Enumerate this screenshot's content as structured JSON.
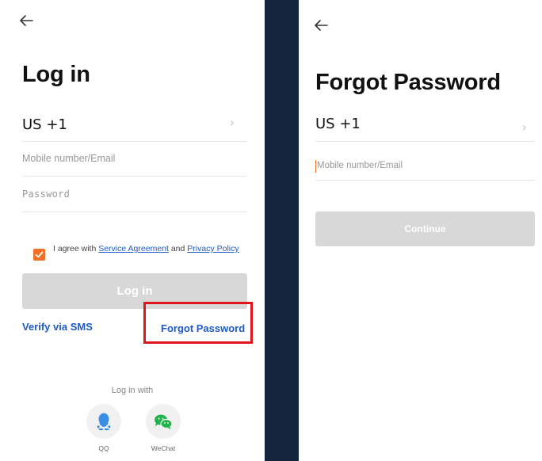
{
  "login": {
    "title": "Log in",
    "country": "US +1",
    "mobile_placeholder": "Mobile number/Email",
    "password_placeholder": "Password",
    "agree_prefix": "I agree with ",
    "service_agreement": "Service Agreement",
    "agree_and": " and ",
    "privacy_policy": "Privacy Policy",
    "login_button": "Log in",
    "verify_sms": "Verify via SMS",
    "forgot_password": "Forgot Password",
    "login_with": "Log in with",
    "social": [
      {
        "label": "QQ",
        "icon": "qq-penguin-icon",
        "color": "#3a8ee6"
      },
      {
        "label": "WeChat",
        "icon": "wechat-icon",
        "color": "#22b34a"
      }
    ]
  },
  "forgot": {
    "title": "Forgot Password",
    "country": "US +1",
    "mobile_placeholder": "Mobile number/Email",
    "continue_button": "Continue"
  },
  "colors": {
    "accent_orange": "#f07028",
    "link_blue": "#1e5bc8",
    "highlight_red": "#e0161e",
    "divider_navy": "#13243d",
    "disabled_button": "#d8d8d8"
  }
}
